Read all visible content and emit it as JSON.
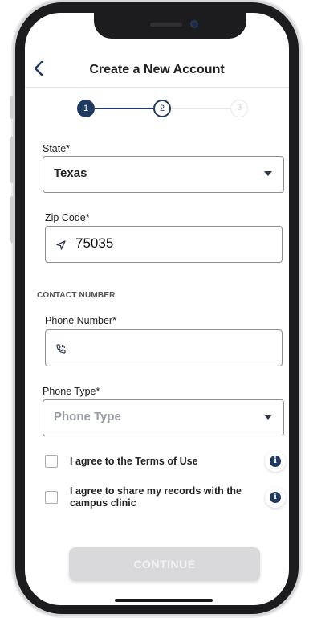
{
  "header": {
    "title": "Create a New Account"
  },
  "stepper": {
    "steps": [
      {
        "label": "1",
        "state": "done"
      },
      {
        "label": "2",
        "state": "current"
      },
      {
        "label": "3",
        "state": "todo"
      }
    ]
  },
  "form": {
    "state": {
      "label": "State*",
      "value": "Texas"
    },
    "zip": {
      "label": "Zip Code*",
      "value": "75035"
    },
    "contact_section": "CONTACT NUMBER",
    "phone": {
      "label": "Phone Number*",
      "value": ""
    },
    "phone_type": {
      "label": "Phone Type*",
      "placeholder": "Phone Type"
    }
  },
  "agreements": [
    {
      "label": "I agree to the Terms of Use",
      "checked": false
    },
    {
      "label": "I agree to share my records with the campus clinic",
      "checked": false
    }
  ],
  "continue_label": "CONTINUE",
  "colors": {
    "primary": "#1e3a5f",
    "border": "#8a8f97",
    "disabled_button": "#d9d9db"
  },
  "icons": [
    "back-chevron-icon",
    "location-arrow-icon",
    "phone-icon",
    "dropdown-caret-icon",
    "info-icon"
  ]
}
